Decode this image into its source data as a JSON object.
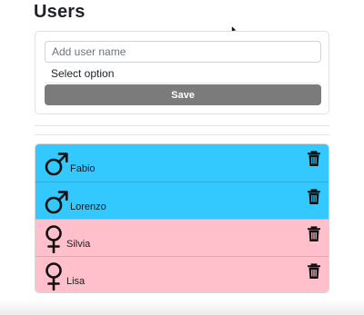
{
  "header": {
    "title": "Users"
  },
  "form": {
    "name_placeholder": "Add user name",
    "name_value": "",
    "select_value": "Select option",
    "save_label": "Save"
  },
  "users": [
    {
      "name": "Fabio",
      "gender": "male",
      "color": "#33c8fe",
      "icon": "male-icon"
    },
    {
      "name": "Lorenzo",
      "gender": "male",
      "color": "#33c8fe",
      "icon": "male-icon"
    },
    {
      "name": "Silvia",
      "gender": "female",
      "color": "#ffc0cc",
      "icon": "female-icon"
    },
    {
      "name": "Lisa",
      "gender": "female",
      "color": "#ffc0cc",
      "icon": "female-icon"
    }
  ],
  "colors": {
    "male": "#33c8fe",
    "female": "#ffc0cc",
    "save_button": "#7b7b7b"
  }
}
